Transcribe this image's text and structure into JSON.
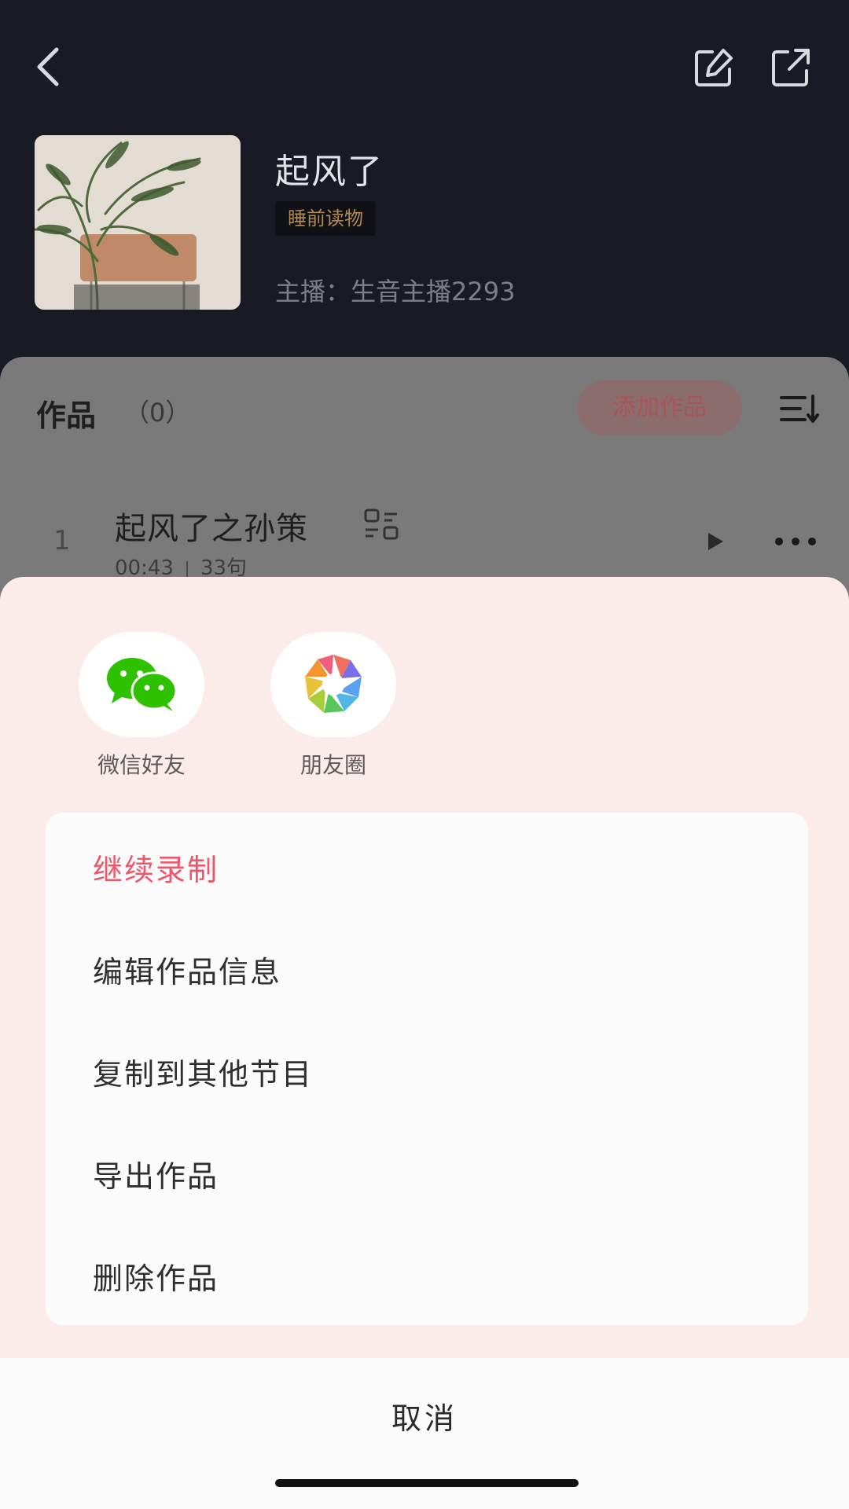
{
  "header": {
    "title": "起风了",
    "tag": "睡前读物",
    "host_label": "主播：",
    "host_name": "生音主播2293"
  },
  "icons": {
    "back": "chevron-left-icon",
    "edit": "edit-icon",
    "share": "share-export-icon",
    "sort": "sort-list-icon",
    "caption": "caption-icon",
    "play": "play-icon",
    "more": "more-dots-icon"
  },
  "works": {
    "label": "作品",
    "count": "（0）",
    "add_button": "添加作品",
    "tracks": [
      {
        "index": "1",
        "title": "起风了之孙策",
        "duration": "00:43",
        "sentences": "33句"
      }
    ]
  },
  "sheet": {
    "share_targets": [
      {
        "label": "微信好友",
        "icon": "wechat-icon"
      },
      {
        "label": "朋友圈",
        "icon": "moments-icon"
      }
    ],
    "menu": [
      {
        "label": "继续录制"
      },
      {
        "label": "编辑作品信息"
      },
      {
        "label": "复制到其他节目"
      },
      {
        "label": "导出作品"
      },
      {
        "label": "删除作品"
      }
    ],
    "cancel": "取消"
  },
  "colors": {
    "accent_red": "#f0566a",
    "sheet_bg": "#fbeceb",
    "header_bg": "#181b24"
  }
}
